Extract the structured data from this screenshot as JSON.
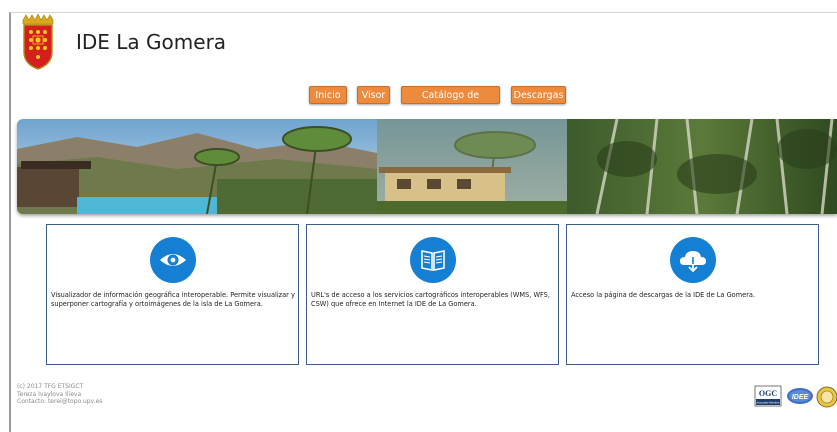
{
  "header": {
    "title": "IDE La Gomera",
    "logo": "coat-of-arms-la-gomera"
  },
  "nav": {
    "items": [
      {
        "label": "Inicio"
      },
      {
        "label": "Visor"
      },
      {
        "label": "Catálogo de servicios"
      },
      {
        "label": "Descargas"
      }
    ],
    "button_color": "#ee8a3c"
  },
  "banner": {
    "icon": "landscape-banner-image"
  },
  "cards": [
    {
      "icon": "eye-icon",
      "text": "Visualizador de información geográfica interoperable. Permite visualizar y superponer cartografía y ortoimágenes de la isla de La Gomera."
    },
    {
      "icon": "book-icon",
      "text": "URL's de acceso a los servicios cartográficos interoperables (WMS, WFS, CSW) que ofrece en Internet la IDE de La Gomera."
    },
    {
      "icon": "cloud-download-icon",
      "text": "Acceso la página de descargas de la IDE de La Gomera."
    }
  ],
  "card_icon_color": "#1580d3",
  "footer": {
    "lines": [
      "(c) 2017 TFG ETSIGCT",
      "Tereza Ivaylova Ilieva",
      "Contacto: terei@topo.upv.es"
    ],
    "logos": [
      "OGC",
      "IDEE",
      "upm-seal"
    ],
    "ogc_sub": "Associate Member"
  }
}
